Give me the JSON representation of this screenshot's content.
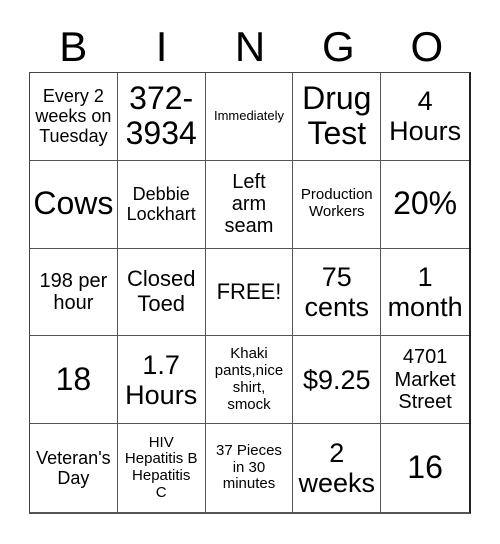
{
  "header": {
    "letters": [
      "B",
      "I",
      "N",
      "G",
      "O"
    ]
  },
  "board": {
    "rows": [
      [
        "Every 2\nweeks on\nTuesday",
        "372-\n3934",
        "Immediately",
        "Drug\nTest",
        "4\nHours"
      ],
      [
        "Cows",
        "Debbie\nLockhart",
        "Left\narm\nseam",
        "Production\nWorkers",
        "20%"
      ],
      [
        "198 per\nhour",
        "Closed\nToed",
        "FREE!",
        "75\ncents",
        "1\nmonth"
      ],
      [
        "18",
        "1.7\nHours",
        "Khaki\npants,nice\nshirt,\nsmock",
        "$9.25",
        "4701\nMarket\nStreet"
      ],
      [
        "Veteran's\nDay",
        "HIV\nHepatitis B\nHepatitis\nC",
        "37 Pieces\nin 30\nminutes",
        "2\nweeks",
        "16"
      ]
    ]
  }
}
